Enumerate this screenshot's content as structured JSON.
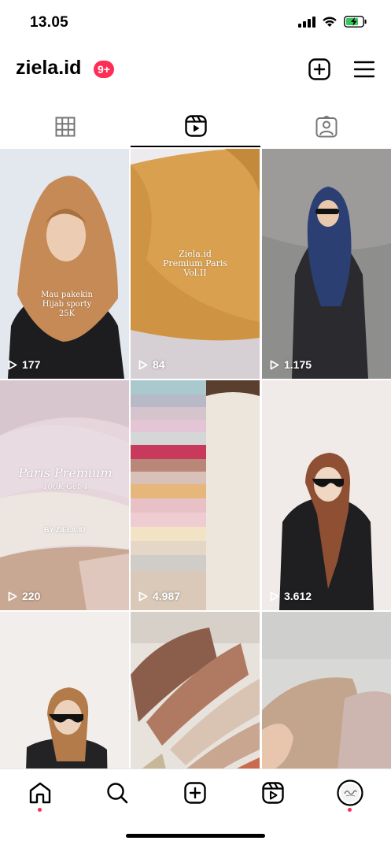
{
  "status_bar": {
    "time": "13.05",
    "icons": [
      "cellular-signal-icon",
      "wifi-icon",
      "battery-charging-icon"
    ]
  },
  "profile": {
    "username": "ziela.id",
    "notification_badge": "9+"
  },
  "header_icons": [
    "add-post-icon",
    "menu-icon"
  ],
  "tabs": [
    {
      "name": "grid",
      "icon": "grid-icon",
      "active": false
    },
    {
      "name": "reels",
      "icon": "reels-icon",
      "active": true
    },
    {
      "name": "tagged",
      "icon": "tagged-icon",
      "active": false
    }
  ],
  "reels": [
    {
      "views": "177",
      "caption": [
        "Mau pakekin",
        "Hijab sporty",
        "25K"
      ]
    },
    {
      "views": "84",
      "caption": [
        "Ziela.id",
        "Premium Paris",
        "Vol.II"
      ]
    },
    {
      "views": "1.175",
      "caption": []
    },
    {
      "views": "220",
      "caption": [
        "Paris Premium",
        "100K Get 4",
        "BY ZIELA.ID"
      ]
    },
    {
      "views": "4.987",
      "caption": []
    },
    {
      "views": "3.612",
      "caption": []
    },
    {
      "views": "",
      "caption": []
    },
    {
      "views": "",
      "caption": []
    },
    {
      "views": "",
      "caption": []
    }
  ],
  "bottom_nav": [
    {
      "name": "home",
      "icon": "home-icon",
      "active": true
    },
    {
      "name": "search",
      "icon": "search-icon"
    },
    {
      "name": "new-post",
      "icon": "add-post-icon"
    },
    {
      "name": "reels",
      "icon": "reels-icon"
    },
    {
      "name": "profile",
      "icon": "profile-avatar-icon",
      "has_notification": true
    }
  ],
  "colors": {
    "badge": "#ff2d55",
    "battery": "#34c759",
    "text": "#000000"
  }
}
